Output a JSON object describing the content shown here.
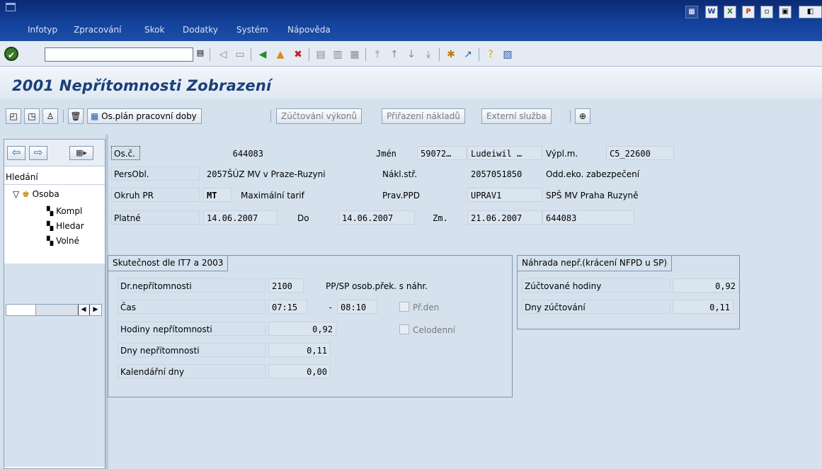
{
  "menu": [
    "Infotyp",
    "Zpracování",
    "Skok",
    "Dodatky",
    "Systém",
    "Nápověda"
  ],
  "toolbar": {
    "cmd_value": ""
  },
  "page_title": "2001 Nepřítomnosti Zobrazení",
  "app_toolbar": {
    "plan_button": "Os.plán pracovní doby",
    "zuctovani_button": "Zúčtování výkonů",
    "prirazeni_button": "Přiřazení nákladů",
    "externi_button": "Externí služba"
  },
  "tree": {
    "search_label": "Hledání",
    "root": "Osoba",
    "children": [
      "Kompl",
      "Hledar",
      "Volné"
    ]
  },
  "header": {
    "osc_label": "Os.č.",
    "osc_value": "644083",
    "jmen_label": "Jmén",
    "jmen_value1": "59072…",
    "jmen_value2": "Ludeiwil …",
    "vyplm_label": "Výpl.m.",
    "vyplm_value": "C5_22600",
    "persobl_label": "PersObl.",
    "persobl_code": "2057",
    "persobl_text": "ŠÚZ MV v Praze-Ruzyni",
    "naklstr_label": "Nákl.stř.",
    "naklstr_value": "2057051850",
    "naklstr_text": "Odd.eko. zabezpečení",
    "okruh_label": "Okruh PR",
    "okruh_code": "MT",
    "okruh_text": "Maximální tarif",
    "pravppd_label": "Prav.PPD",
    "pravppd_value": "UPRAV1",
    "pravppd_text": "SPŠ MV Praha Ruzyně",
    "platne_label": "Platné",
    "platne_value": "14.06.2007",
    "do_label": "Do",
    "do_value": "14.06.2007",
    "zm_label": "Zm.",
    "zm_value": "21.06.2007",
    "zm_user": "644083"
  },
  "group1": {
    "title": "Skutečnost dle IT7 a 2003",
    "dr_label": "Dr.nepřítomnosti",
    "dr_value": "2100",
    "dr_text": "PP/SP osob.přek. s náhr.",
    "cas_label": "Čas",
    "cas_from": "07:15",
    "cas_dash": "-",
    "cas_to": "08:10",
    "prden_label": "Př.den",
    "hodiny_label": "Hodiny nepřítomnosti",
    "hodiny_value": "0,92",
    "celodenni_label": "Celodenní",
    "dny_label": "Dny nepřítomnosti",
    "dny_value": "0,11",
    "kal_label": "Kalendářní dny",
    "kal_value": "0,00"
  },
  "group2": {
    "title": "Náhrada nepř.(krácení NFPD u SP)",
    "zuct_label": "Zúčtované hodiny",
    "zuct_value": "0,92",
    "dny_label": "Dny zúčtování",
    "dny_value": "0,11"
  },
  "colors": {
    "menubar": "#14439d",
    "background": "#d5e1ed",
    "title": "#1b3f78"
  }
}
